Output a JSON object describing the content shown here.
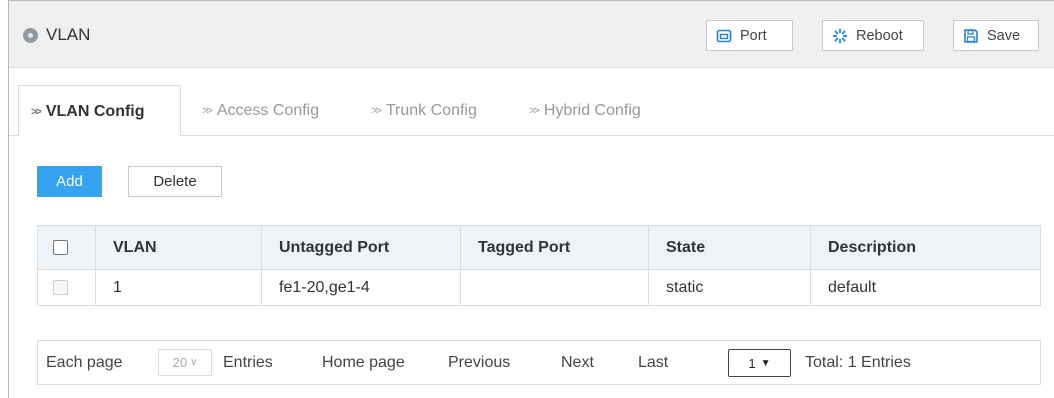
{
  "header": {
    "title": "VLAN",
    "buttons": {
      "port": "Port",
      "reboot": "Reboot",
      "save": "Save"
    }
  },
  "tabs": [
    {
      "label": "VLAN Config",
      "active": true
    },
    {
      "label": "Access Config",
      "active": false
    },
    {
      "label": "Trunk Config",
      "active": false
    },
    {
      "label": "Hybrid Config",
      "active": false
    }
  ],
  "actions": {
    "add": "Add",
    "delete": "Delete"
  },
  "table": {
    "columns": [
      "VLAN",
      "Untagged Port",
      "Tagged Port",
      "State",
      "Description"
    ],
    "rows": [
      {
        "vlan": "1",
        "untagged": "fe1-20,ge1-4",
        "tagged": "",
        "state": "static",
        "description": "default"
      }
    ]
  },
  "pager": {
    "each_page": "Each page",
    "page_size": "20",
    "entries": "Entries",
    "home": "Home page",
    "previous": "Previous",
    "next": "Next",
    "last": "Last",
    "page": "1",
    "total": "Total: 1 Entries"
  },
  "colors": {
    "accent": "#36a3f0",
    "header_bg": "#f0f0f0",
    "table_header_bg": "#eef3f7",
    "icon_blue": "#2b7fd6"
  }
}
